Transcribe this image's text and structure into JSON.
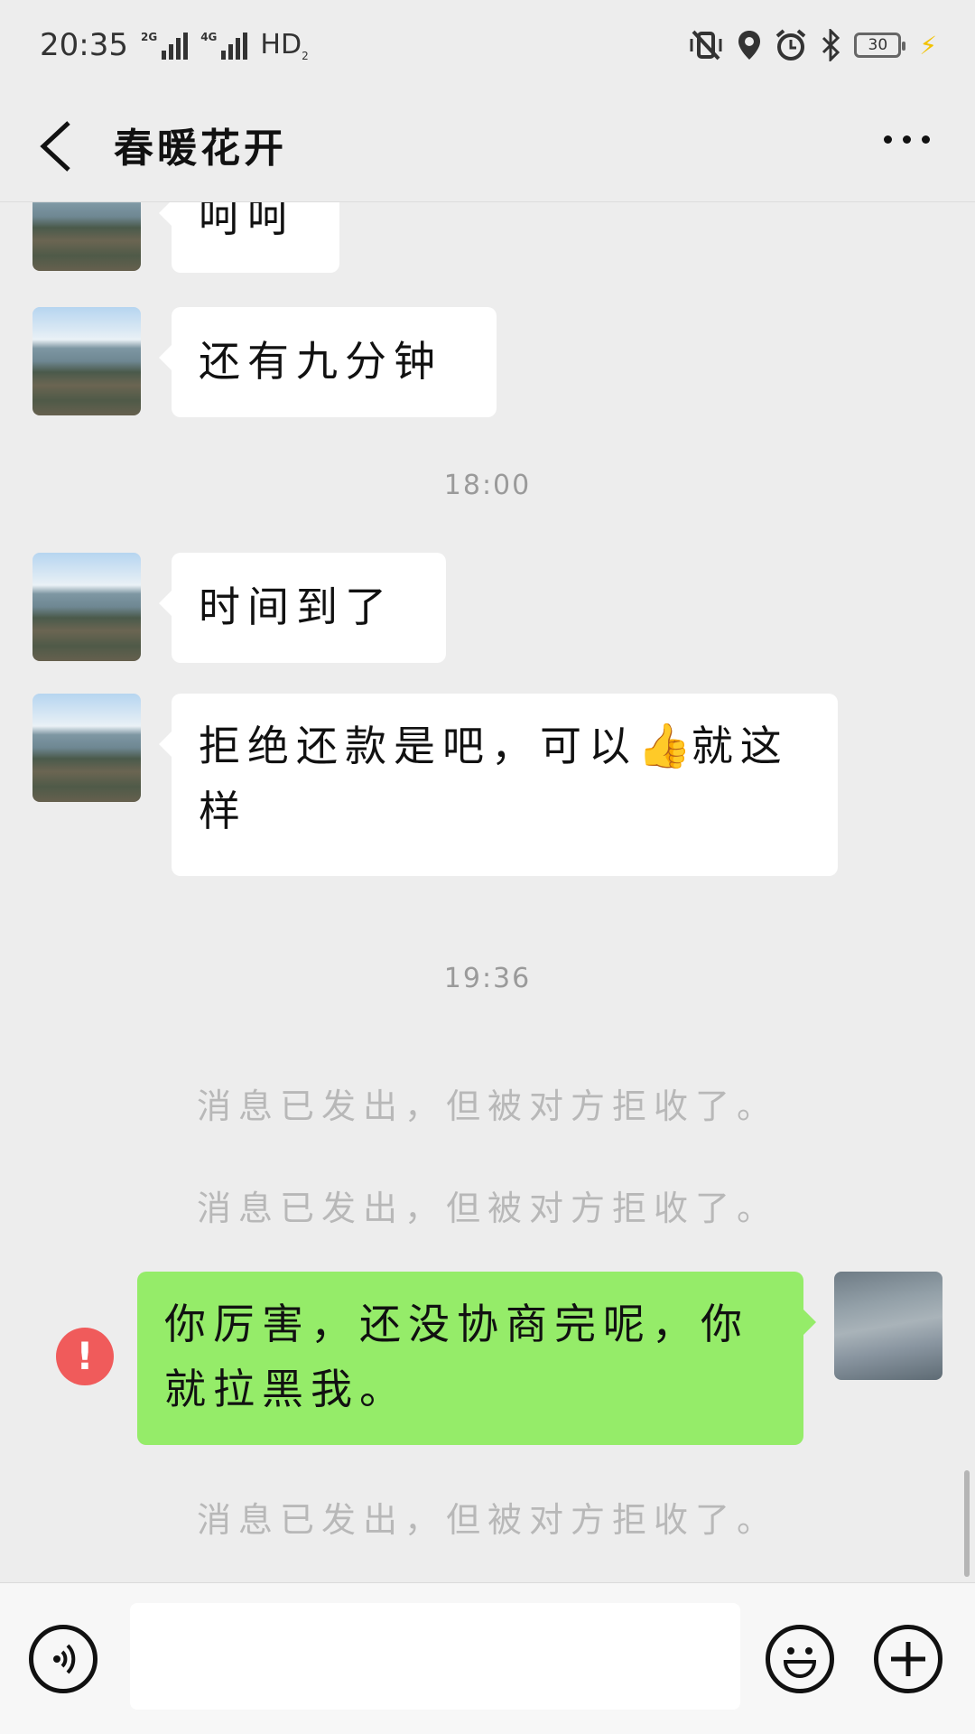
{
  "status_bar": {
    "time": "20:35",
    "network_1": "2G",
    "network_2": "4G",
    "hd": "HD",
    "hd_sub": "2",
    "battery": "30"
  },
  "header": {
    "title": "春暖花开"
  },
  "messages": [
    {
      "sender": "other",
      "text": "呵呵"
    },
    {
      "sender": "other",
      "text": "还有九分钟"
    },
    {
      "time": "18:00"
    },
    {
      "sender": "other",
      "text": "时间到了"
    },
    {
      "sender": "other",
      "text_before_emoji": "拒绝还款是吧，可以",
      "emoji": "👍",
      "text_after_emoji": "就这样"
    },
    {
      "time": "19:36"
    },
    {
      "system": "消息已发出，但被对方拒收了。"
    },
    {
      "system": "消息已发出，但被对方拒收了。"
    },
    {
      "sender": "me",
      "text": "你厉害，还没协商完呢，你就拉黑我。",
      "status": "!"
    },
    {
      "system": "消息已发出，但被对方拒收了。"
    }
  ],
  "icons": {
    "back": "chevron-left",
    "more": "ellipsis",
    "voice": "voice",
    "emoji": "smiley",
    "add": "plus"
  }
}
